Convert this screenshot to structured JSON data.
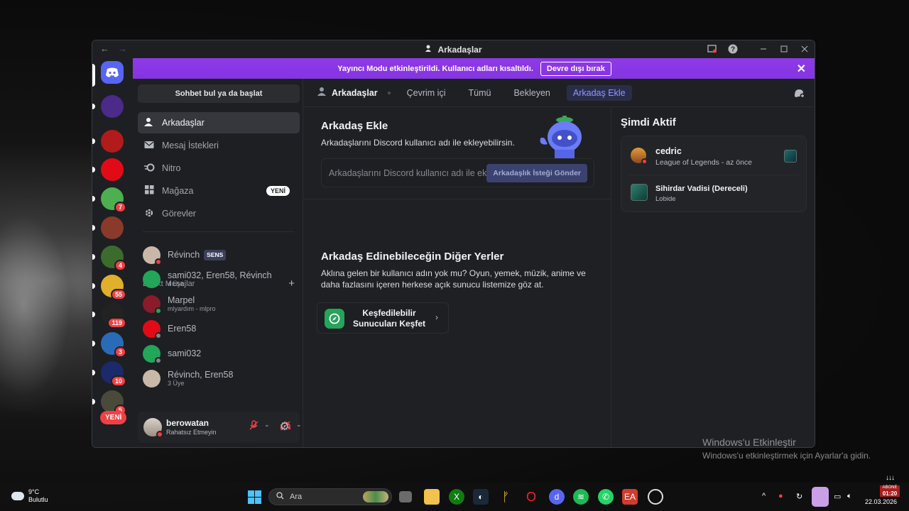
{
  "window": {
    "title": "Arkadaşlar",
    "nav_back": "←",
    "nav_forward": "→"
  },
  "banner": {
    "text": "Yayıncı Modu etkinleştirildi. Kullanıcı adları kısaltıldı.",
    "button": "Devre dışı bırak"
  },
  "guilds": [
    {
      "icon": "discord-home-icon",
      "color": "#5865f2",
      "badge": ""
    },
    {
      "icon": "server-5-icon",
      "color": "#4b2a8a",
      "badge": ""
    },
    {
      "icon": "server-wolf-icon",
      "color": "#b11b1b",
      "badge": ""
    },
    {
      "icon": "server-turkey-icon",
      "color": "#e30a17",
      "badge": ""
    },
    {
      "icon": "server-colorful-icon",
      "color": "#4caf50",
      "badge": "7"
    },
    {
      "icon": "server-anime-icon",
      "color": "#8a3a2a",
      "badge": ""
    },
    {
      "icon": "server-character-icon",
      "color": "#3c6b2e",
      "badge": "4"
    },
    {
      "icon": "server-yellow-icon",
      "color": "#e0b02a",
      "badge": "55"
    },
    {
      "icon": "server-mountain-icon",
      "color": "#222222",
      "badge": "119"
    },
    {
      "icon": "server-ring-icon",
      "color": "#2a6bb8",
      "badge": "3"
    },
    {
      "icon": "server-blue-icon",
      "color": "#1a2a6b",
      "badge": "10"
    },
    {
      "icon": "server-group-icon",
      "color": "#4a4a3a",
      "badge": "5"
    }
  ],
  "guild_new_label": "YENİ",
  "sidebar": {
    "search_label": "Sohbet bul ya da başlat",
    "nav": [
      {
        "label": "Arkadaşlar",
        "icon": "friends-icon"
      },
      {
        "label": "Mesaj İstekleri",
        "icon": "mail-icon"
      },
      {
        "label": "Nitro",
        "icon": "nitro-icon"
      },
      {
        "label": "Mağaza",
        "icon": "shop-icon",
        "tag": "YENİ"
      },
      {
        "label": "Görevler",
        "icon": "quests-icon"
      }
    ],
    "dm_header": "Direkt Mesajlar",
    "dm_add": "+",
    "dms": [
      {
        "name": "Révinch",
        "sub": "",
        "tag": "SENS",
        "status": "dnd",
        "color": "#c9b8a8"
      },
      {
        "name": "sami032, Eren58, Révinch",
        "sub": "4 Üye",
        "status": "",
        "color": "#23a55a"
      },
      {
        "name": "Marpel",
        "sub": "mlyardım - mlpro",
        "status": "online",
        "color": "#8b1a2b"
      },
      {
        "name": "Eren58",
        "sub": "",
        "status": "offline",
        "color": "#e30a17"
      },
      {
        "name": "sami032",
        "sub": "",
        "status": "offline",
        "color": "#23a55a"
      },
      {
        "name": "Révinch, Eren58",
        "sub": "3 Üye",
        "status": "",
        "color": "#c9b8a8"
      }
    ]
  },
  "user": {
    "name": "berowatan",
    "status": "Rahatsız Etmeyin"
  },
  "topbar": {
    "title": "Arkadaşlar",
    "tabs": [
      "Çevrim içi",
      "Tümü",
      "Bekleyen"
    ],
    "add_tab": "Arkadaş Ekle"
  },
  "add_friend": {
    "title": "Arkadaş Ekle",
    "desc": "Arkadaşlarını Discord kullanıcı adı ile ekleyebilirsin.",
    "placeholder": "Arkadaşlarını Discord kullanıcı adı ile ekleyebilirsin.",
    "button": "Arkadaşlık İsteği Gönder"
  },
  "other_places": {
    "title": "Arkadaş Edinebileceğin Diğer Yerler",
    "desc": "Aklına gelen bir kullanıcı adın yok mu? Oyun, yemek, müzik, anime ve daha fazlasını içeren herkese açık sunucu listemize göz at.",
    "explore_label": "Keşfedilebilir Sunucuları Keşfet"
  },
  "active_now": {
    "title": "Şimdi Aktif",
    "user_name": "cedric",
    "user_activity": "League of Legends - az önce",
    "rich_title": "Sihirdar Vadisi (Dereceli)",
    "rich_sub": "Lobide"
  },
  "watermark": {
    "line1": "Windows'u Etkinleştir",
    "line2": "Windows'u etkinleştirmek için Ayarlar'a gidin."
  },
  "taskbar": {
    "temp": "9°C",
    "weather": "Bulutlu",
    "search_placeholder": "Ara",
    "date": "22.03.2026",
    "time": "01:20",
    "abone": "ABONE"
  }
}
